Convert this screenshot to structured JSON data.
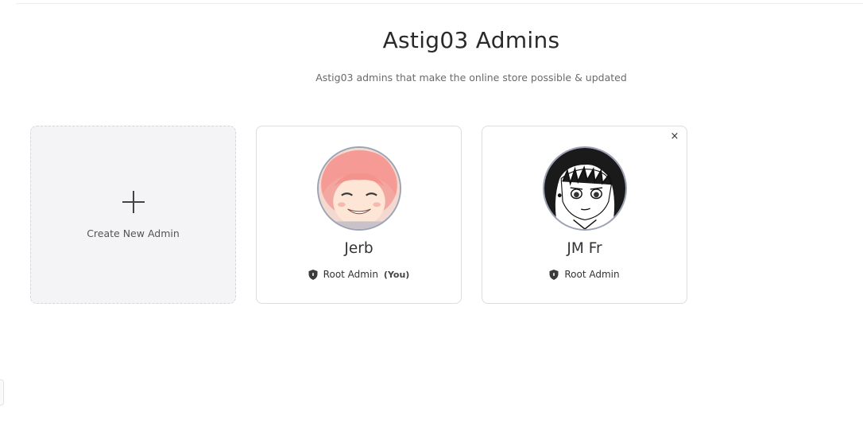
{
  "header": {
    "title": "Astig03 Admins",
    "subtitle": "Astig03 admins that make the online store possible & updated"
  },
  "create_card": {
    "label": "Create New Admin",
    "icon": "plus-icon"
  },
  "admins": [
    {
      "name": "Jerb",
      "role": "Root Admin",
      "you_tag": "(You)",
      "role_icon": "shield-icon",
      "avatar": "pink-haired-anime-girl-avatar"
    },
    {
      "name": "JM Fr",
      "role": "Root Admin",
      "role_icon": "shield-icon",
      "avatar": "manga-girl-avatar",
      "remove_label": "×"
    }
  ],
  "colors": {
    "create_card_bg": "#f4f4f6",
    "avatar_border": "#9da3b4",
    "text": "#333333",
    "subtitle": "#6a6a6a"
  }
}
